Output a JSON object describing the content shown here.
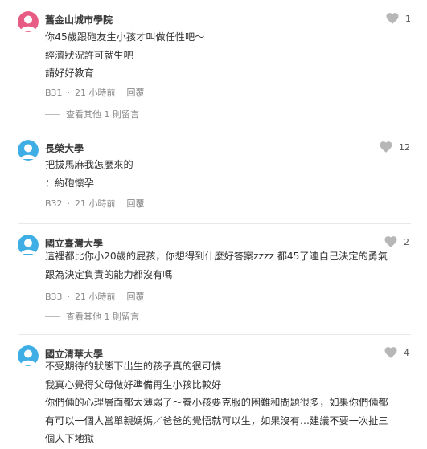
{
  "heart_color": "#b7b7b7",
  "avatar_colors": {
    "pink": "#e65c84",
    "blue": "#3eaee5"
  },
  "comments": [
    {
      "school": "舊金山城市學院",
      "avatar": "pink",
      "likes": "1",
      "lines": [
        "你45歲跟砲友生小孩才叫做任性吧～",
        "經濟狀況許可就生吧",
        "請好好教育"
      ],
      "floor": "B31",
      "dot": "·",
      "time": "21 小時前",
      "reply": "回覆",
      "more_replies": "查看其他 1 則留言"
    },
    {
      "school": "長榮大學",
      "avatar": "blue",
      "likes": "12",
      "lines": [
        "把拔馬麻我怎麼來的",
        "：約砲懷孕"
      ],
      "floor": "B32",
      "dot": "·",
      "time": "21 小時前",
      "reply": "回覆"
    },
    {
      "school": "國立臺灣大學",
      "avatar": "blue",
      "likes": "2",
      "lines": [
        "這裡都比你小20歲的屁孩，你想得到什麼好答案zzzz 都45了連自己決定的勇氣",
        "跟為決定負責的能力都沒有嗎"
      ],
      "floor": "B33",
      "dot": "·",
      "time": "21 小時前",
      "reply": "回覆",
      "more_replies": "查看其他 1 則留言"
    },
    {
      "school": "國立清華大學",
      "avatar": "blue",
      "likes": "4",
      "lines": [
        "不受期待的狀態下出生的孩子真的很可憐",
        "我真心覺得父母做好準備再生小孩比較好",
        "你們倆的心理層面都太薄弱了～養小孩要克服的困難和問題很多，如果你們倆都",
        "有可以一個人當單親媽媽／爸爸的覺悟就可以生，如果沒有…建議不要一次扯三",
        "個人下地獄"
      ]
    }
  ]
}
